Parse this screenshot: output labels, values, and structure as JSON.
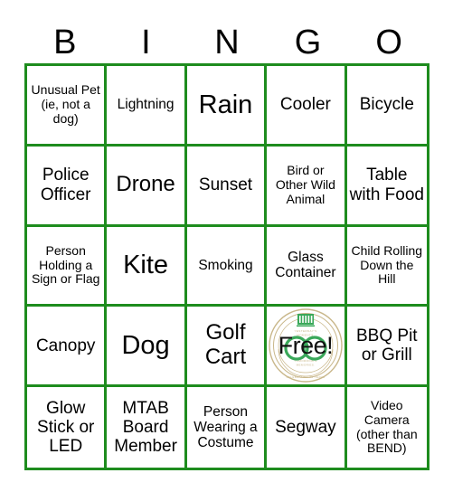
{
  "card": {
    "title": "BINGO",
    "grid_color": "#1e8c1e",
    "text_color": "#000000",
    "background": "#ffffff",
    "columns": 5,
    "rows": 5
  },
  "header": {
    "letters": [
      "B",
      "I",
      "N",
      "G",
      "O"
    ]
  },
  "free_space": {
    "label": "Free!",
    "position": {
      "row": 4,
      "column": 4
    },
    "logo": {
      "name": "mtab-circular-seal-logo",
      "ring_color": "#c9b78a",
      "mark_color": "#3aa85a",
      "top_glyph": "crown-emblem",
      "inner_text_top": "YESTERDAY'S MOMENTS,",
      "inner_text_bottom": "TOMORROW'S MEMORIES."
    }
  },
  "cells": [
    {
      "id": "b1",
      "label": "Unusual Pet (ie, not a dog)",
      "size": "xs"
    },
    {
      "id": "i1",
      "label": "Lightning",
      "size": "sm"
    },
    {
      "id": "n1",
      "label": "Rain",
      "size": "xl"
    },
    {
      "id": "g1",
      "label": "Cooler",
      "size": "md"
    },
    {
      "id": "o1",
      "label": "Bicycle",
      "size": "md"
    },
    {
      "id": "b2",
      "label": "Police Officer",
      "size": "md"
    },
    {
      "id": "i2",
      "label": "Drone",
      "size": "lg"
    },
    {
      "id": "n2",
      "label": "Sunset",
      "size": "md"
    },
    {
      "id": "g2",
      "label": "Bird or Other Wild Animal",
      "size": "xs"
    },
    {
      "id": "o2",
      "label": "Table with Food",
      "size": "md"
    },
    {
      "id": "b3",
      "label": "Person Holding a Sign or Flag",
      "size": "xs"
    },
    {
      "id": "i3",
      "label": "Kite",
      "size": "xl"
    },
    {
      "id": "n3",
      "label": "Smoking",
      "size": "sm"
    },
    {
      "id": "g3",
      "label": "Glass Container",
      "size": "sm"
    },
    {
      "id": "o3",
      "label": "Child Rolling Down the Hill",
      "size": "xs"
    },
    {
      "id": "b4",
      "label": "Canopy",
      "size": "md"
    },
    {
      "id": "i4",
      "label": "Dog",
      "size": "xl"
    },
    {
      "id": "n4",
      "label": "Golf Cart",
      "size": "lg"
    },
    {
      "id": "g4",
      "label": "Free!",
      "size": "free"
    },
    {
      "id": "o4",
      "label": "BBQ Pit or Grill",
      "size": "md"
    },
    {
      "id": "b5",
      "label": "Glow Stick or LED",
      "size": "md"
    },
    {
      "id": "i5",
      "label": "MTAB Board Member",
      "size": "md"
    },
    {
      "id": "n5",
      "label": "Person Wearing a Costume",
      "size": "sm"
    },
    {
      "id": "g5",
      "label": "Segway",
      "size": "md"
    },
    {
      "id": "o5",
      "label": "Video Camera (other than BEND)",
      "size": "xs"
    }
  ]
}
